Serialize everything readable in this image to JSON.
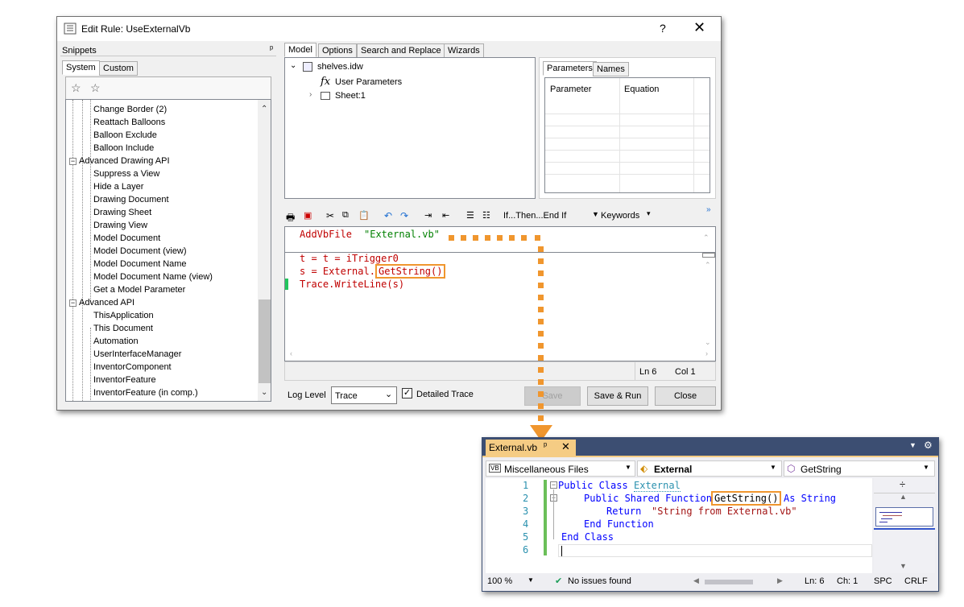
{
  "dialog": {
    "title": "Edit Rule: UseExternalVb",
    "help": "?",
    "close": "✕"
  },
  "snippets": {
    "header": "Snippets",
    "pin": "🖈",
    "tabs": [
      "System",
      "Custom"
    ],
    "items": [
      "Change Border (2)",
      "Reattach Balloons",
      "Balloon Exclude",
      "Balloon Include",
      "Advanced Drawing API",
      "Suppress a View",
      "Hide a Layer",
      "Drawing Document",
      "Drawing Sheet",
      "Drawing View",
      "Model Document",
      "Model Document (view)",
      "Model Document Name",
      "Model Document Name (view)",
      "Get a Model Parameter",
      "Advanced API",
      "ThisApplication",
      "This Document",
      "Automation",
      "UserInterfaceManager",
      "InventorComponent",
      "InventorFeature",
      "InventorFeature (in comp.)"
    ]
  },
  "model": {
    "tabs": [
      "Model",
      "Options",
      "Search and Replace",
      "Wizards"
    ],
    "tree": [
      "shelves.idw",
      "User Parameters",
      "Sheet:1"
    ],
    "fx": "fx"
  },
  "params": {
    "tabs": [
      "Parameters",
      "Names"
    ],
    "columns": [
      "Parameter",
      "Equation"
    ]
  },
  "editor": {
    "toolbar_text": "If...Then...End If",
    "keywords": "Keywords",
    "line1_kw": "AddVbFile",
    "line1_str": "\"External.vb\"",
    "line2": "t = iTrigger0",
    "line3_a": "s = External.",
    "line3_b": "GetString()",
    "line4": "Trace.WriteLine(s)",
    "status_ln": "Ln 6",
    "status_col": "Col 1"
  },
  "footer": {
    "log_label": "Log Level",
    "log_value": "Trace",
    "detailed": "Detailed Trace",
    "save": "Save",
    "save_run": "Save & Run",
    "close": "Close"
  },
  "vs": {
    "tab": "External.vb",
    "nav_left": "Miscellaneous Files",
    "nav_mid": "External",
    "nav_right": "GetString",
    "line_numbers": [
      "1",
      "2",
      "3",
      "4",
      "5",
      "6"
    ],
    "code": {
      "l1_kw": "Public Class",
      "l1_name": "External",
      "l2_kw": "Public Shared Function",
      "l2_fn": "GetString()",
      "l2_as": "As String",
      "l3_kw": "Return",
      "l3_str": "\"String from External.vb\"",
      "l4": "End Function",
      "l5": "End Class"
    },
    "zoom": "100 %",
    "issues": "No issues found",
    "ln": "Ln: 6",
    "ch": "Ch: 1",
    "spc": "SPC",
    "crlf": "CRLF"
  },
  "colors": {
    "accent_orange": "#f0962e",
    "vs_frame": "#3c4e72",
    "vb_keyword": "#0000ff",
    "string_red": "#a31515",
    "ilogic_red": "#c00000",
    "ilogic_green": "#008000"
  }
}
